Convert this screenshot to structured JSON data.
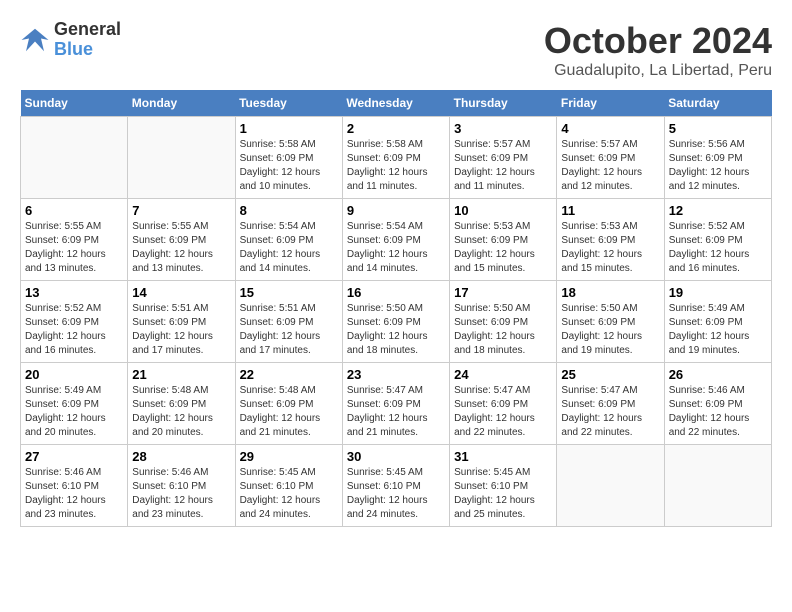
{
  "header": {
    "logo_line1": "General",
    "logo_line2": "Blue",
    "title": "October 2024",
    "subtitle": "Guadalupito, La Libertad, Peru"
  },
  "calendar": {
    "weekdays": [
      "Sunday",
      "Monday",
      "Tuesday",
      "Wednesday",
      "Thursday",
      "Friday",
      "Saturday"
    ],
    "weeks": [
      [
        {
          "day": "",
          "info": ""
        },
        {
          "day": "",
          "info": ""
        },
        {
          "day": "1",
          "info": "Sunrise: 5:58 AM\nSunset: 6:09 PM\nDaylight: 12 hours\nand 10 minutes."
        },
        {
          "day": "2",
          "info": "Sunrise: 5:58 AM\nSunset: 6:09 PM\nDaylight: 12 hours\nand 11 minutes."
        },
        {
          "day": "3",
          "info": "Sunrise: 5:57 AM\nSunset: 6:09 PM\nDaylight: 12 hours\nand 11 minutes."
        },
        {
          "day": "4",
          "info": "Sunrise: 5:57 AM\nSunset: 6:09 PM\nDaylight: 12 hours\nand 12 minutes."
        },
        {
          "day": "5",
          "info": "Sunrise: 5:56 AM\nSunset: 6:09 PM\nDaylight: 12 hours\nand 12 minutes."
        }
      ],
      [
        {
          "day": "6",
          "info": "Sunrise: 5:55 AM\nSunset: 6:09 PM\nDaylight: 12 hours\nand 13 minutes."
        },
        {
          "day": "7",
          "info": "Sunrise: 5:55 AM\nSunset: 6:09 PM\nDaylight: 12 hours\nand 13 minutes."
        },
        {
          "day": "8",
          "info": "Sunrise: 5:54 AM\nSunset: 6:09 PM\nDaylight: 12 hours\nand 14 minutes."
        },
        {
          "day": "9",
          "info": "Sunrise: 5:54 AM\nSunset: 6:09 PM\nDaylight: 12 hours\nand 14 minutes."
        },
        {
          "day": "10",
          "info": "Sunrise: 5:53 AM\nSunset: 6:09 PM\nDaylight: 12 hours\nand 15 minutes."
        },
        {
          "day": "11",
          "info": "Sunrise: 5:53 AM\nSunset: 6:09 PM\nDaylight: 12 hours\nand 15 minutes."
        },
        {
          "day": "12",
          "info": "Sunrise: 5:52 AM\nSunset: 6:09 PM\nDaylight: 12 hours\nand 16 minutes."
        }
      ],
      [
        {
          "day": "13",
          "info": "Sunrise: 5:52 AM\nSunset: 6:09 PM\nDaylight: 12 hours\nand 16 minutes."
        },
        {
          "day": "14",
          "info": "Sunrise: 5:51 AM\nSunset: 6:09 PM\nDaylight: 12 hours\nand 17 minutes."
        },
        {
          "day": "15",
          "info": "Sunrise: 5:51 AM\nSunset: 6:09 PM\nDaylight: 12 hours\nand 17 minutes."
        },
        {
          "day": "16",
          "info": "Sunrise: 5:50 AM\nSunset: 6:09 PM\nDaylight: 12 hours\nand 18 minutes."
        },
        {
          "day": "17",
          "info": "Sunrise: 5:50 AM\nSunset: 6:09 PM\nDaylight: 12 hours\nand 18 minutes."
        },
        {
          "day": "18",
          "info": "Sunrise: 5:50 AM\nSunset: 6:09 PM\nDaylight: 12 hours\nand 19 minutes."
        },
        {
          "day": "19",
          "info": "Sunrise: 5:49 AM\nSunset: 6:09 PM\nDaylight: 12 hours\nand 19 minutes."
        }
      ],
      [
        {
          "day": "20",
          "info": "Sunrise: 5:49 AM\nSunset: 6:09 PM\nDaylight: 12 hours\nand 20 minutes."
        },
        {
          "day": "21",
          "info": "Sunrise: 5:48 AM\nSunset: 6:09 PM\nDaylight: 12 hours\nand 20 minutes."
        },
        {
          "day": "22",
          "info": "Sunrise: 5:48 AM\nSunset: 6:09 PM\nDaylight: 12 hours\nand 21 minutes."
        },
        {
          "day": "23",
          "info": "Sunrise: 5:47 AM\nSunset: 6:09 PM\nDaylight: 12 hours\nand 21 minutes."
        },
        {
          "day": "24",
          "info": "Sunrise: 5:47 AM\nSunset: 6:09 PM\nDaylight: 12 hours\nand 22 minutes."
        },
        {
          "day": "25",
          "info": "Sunrise: 5:47 AM\nSunset: 6:09 PM\nDaylight: 12 hours\nand 22 minutes."
        },
        {
          "day": "26",
          "info": "Sunrise: 5:46 AM\nSunset: 6:09 PM\nDaylight: 12 hours\nand 22 minutes."
        }
      ],
      [
        {
          "day": "27",
          "info": "Sunrise: 5:46 AM\nSunset: 6:10 PM\nDaylight: 12 hours\nand 23 minutes."
        },
        {
          "day": "28",
          "info": "Sunrise: 5:46 AM\nSunset: 6:10 PM\nDaylight: 12 hours\nand 23 minutes."
        },
        {
          "day": "29",
          "info": "Sunrise: 5:45 AM\nSunset: 6:10 PM\nDaylight: 12 hours\nand 24 minutes."
        },
        {
          "day": "30",
          "info": "Sunrise: 5:45 AM\nSunset: 6:10 PM\nDaylight: 12 hours\nand 24 minutes."
        },
        {
          "day": "31",
          "info": "Sunrise: 5:45 AM\nSunset: 6:10 PM\nDaylight: 12 hours\nand 25 minutes."
        },
        {
          "day": "",
          "info": ""
        },
        {
          "day": "",
          "info": ""
        }
      ]
    ]
  }
}
